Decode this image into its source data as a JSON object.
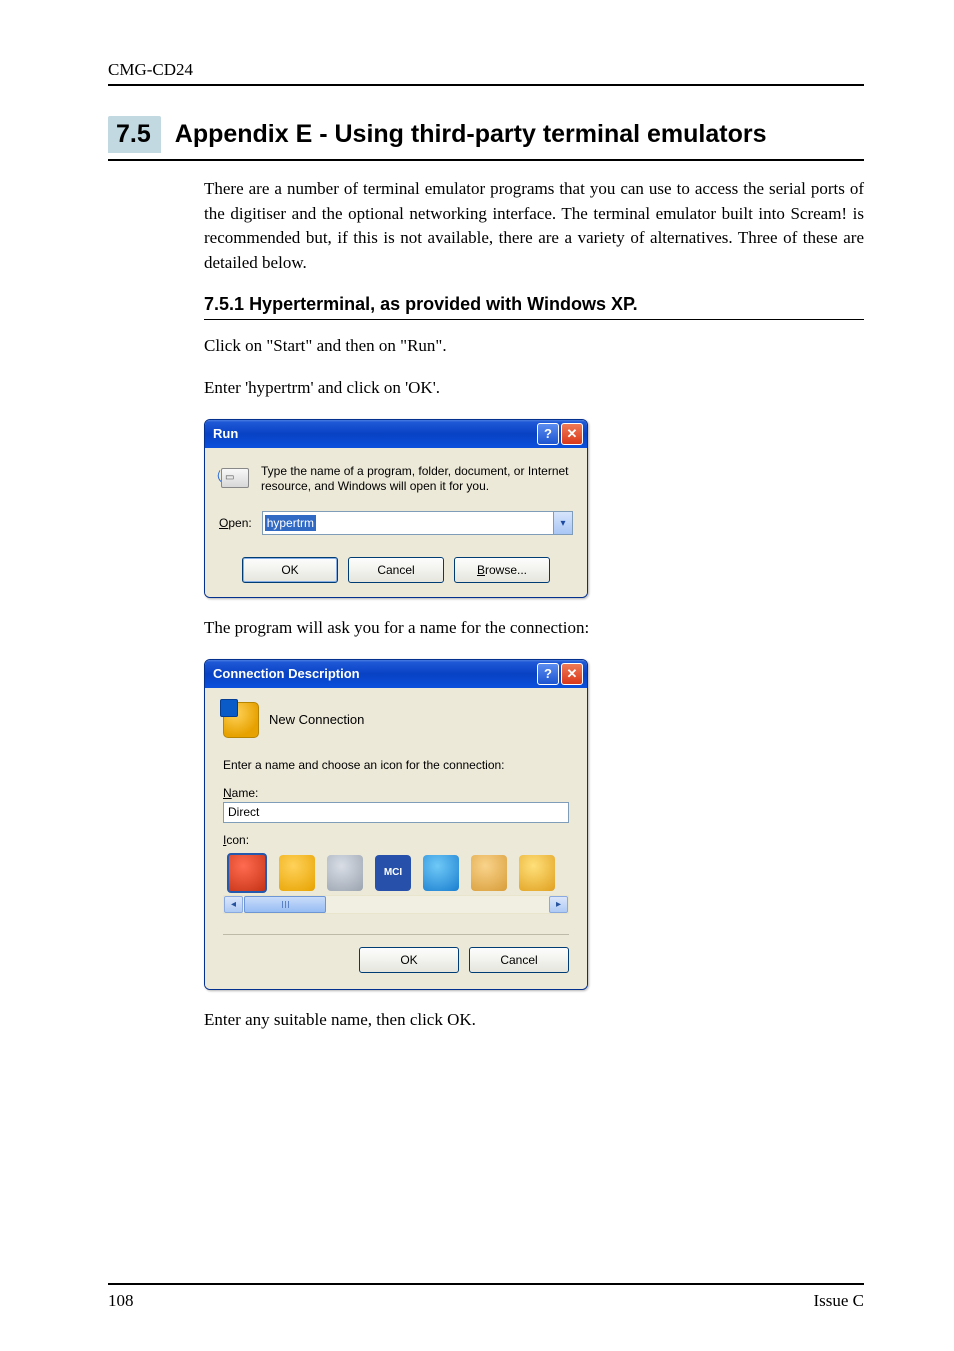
{
  "header": {
    "running": "CMG-CD24"
  },
  "section": {
    "number": "7.5",
    "title": "Appendix E - Using third-party terminal emulators",
    "intro": "There are a number of terminal emulator programs that you can use to access the serial ports of the digitiser and the optional networking interface.  The terminal emulator built into Scream! is recommended but, if this is not available, there are a variety of alternatives.  Three of these are detailed below."
  },
  "subsection": {
    "number": "7.5.1",
    "title": "Hyperterminal, as provided with Windows XP."
  },
  "body": {
    "line1": "Click on \"Start\" and then on \"Run\".",
    "line2": "Enter 'hypertrm' and click on 'OK'.",
    "line3": "The program will ask you for a name for the connection:",
    "line4": "Enter any suitable name, then click OK."
  },
  "run_dialog": {
    "title": "Run",
    "help": "?",
    "close": "✕",
    "icon_name": "run-icon",
    "explanation": "Type the name of a program, folder, document, or Internet resource, and Windows will open it for you.",
    "open_label_pre": "O",
    "open_label_post": "pen:",
    "open_value": "hypertrm",
    "caret_name": "chevron-down-icon",
    "ok": "OK",
    "cancel": "Cancel",
    "browse_pre": "B",
    "browse_post": "rowse..."
  },
  "conn_dialog": {
    "title": "Connection Description",
    "help": "?",
    "close": "✕",
    "caption": "New Connection",
    "prompt": "Enter a name and choose an icon for the connection:",
    "name_label_pre": "N",
    "name_label_post": "ame:",
    "name_value": "Direct",
    "icon_label_pre": "I",
    "icon_label_post": "con:",
    "icons": {
      "a": "",
      "b": "",
      "c": "",
      "d": "MCI",
      "e": "",
      "f": "",
      "g": ""
    },
    "ok": "OK",
    "cancel": "Cancel"
  },
  "footer": {
    "page": "108",
    "issue": "Issue C"
  }
}
